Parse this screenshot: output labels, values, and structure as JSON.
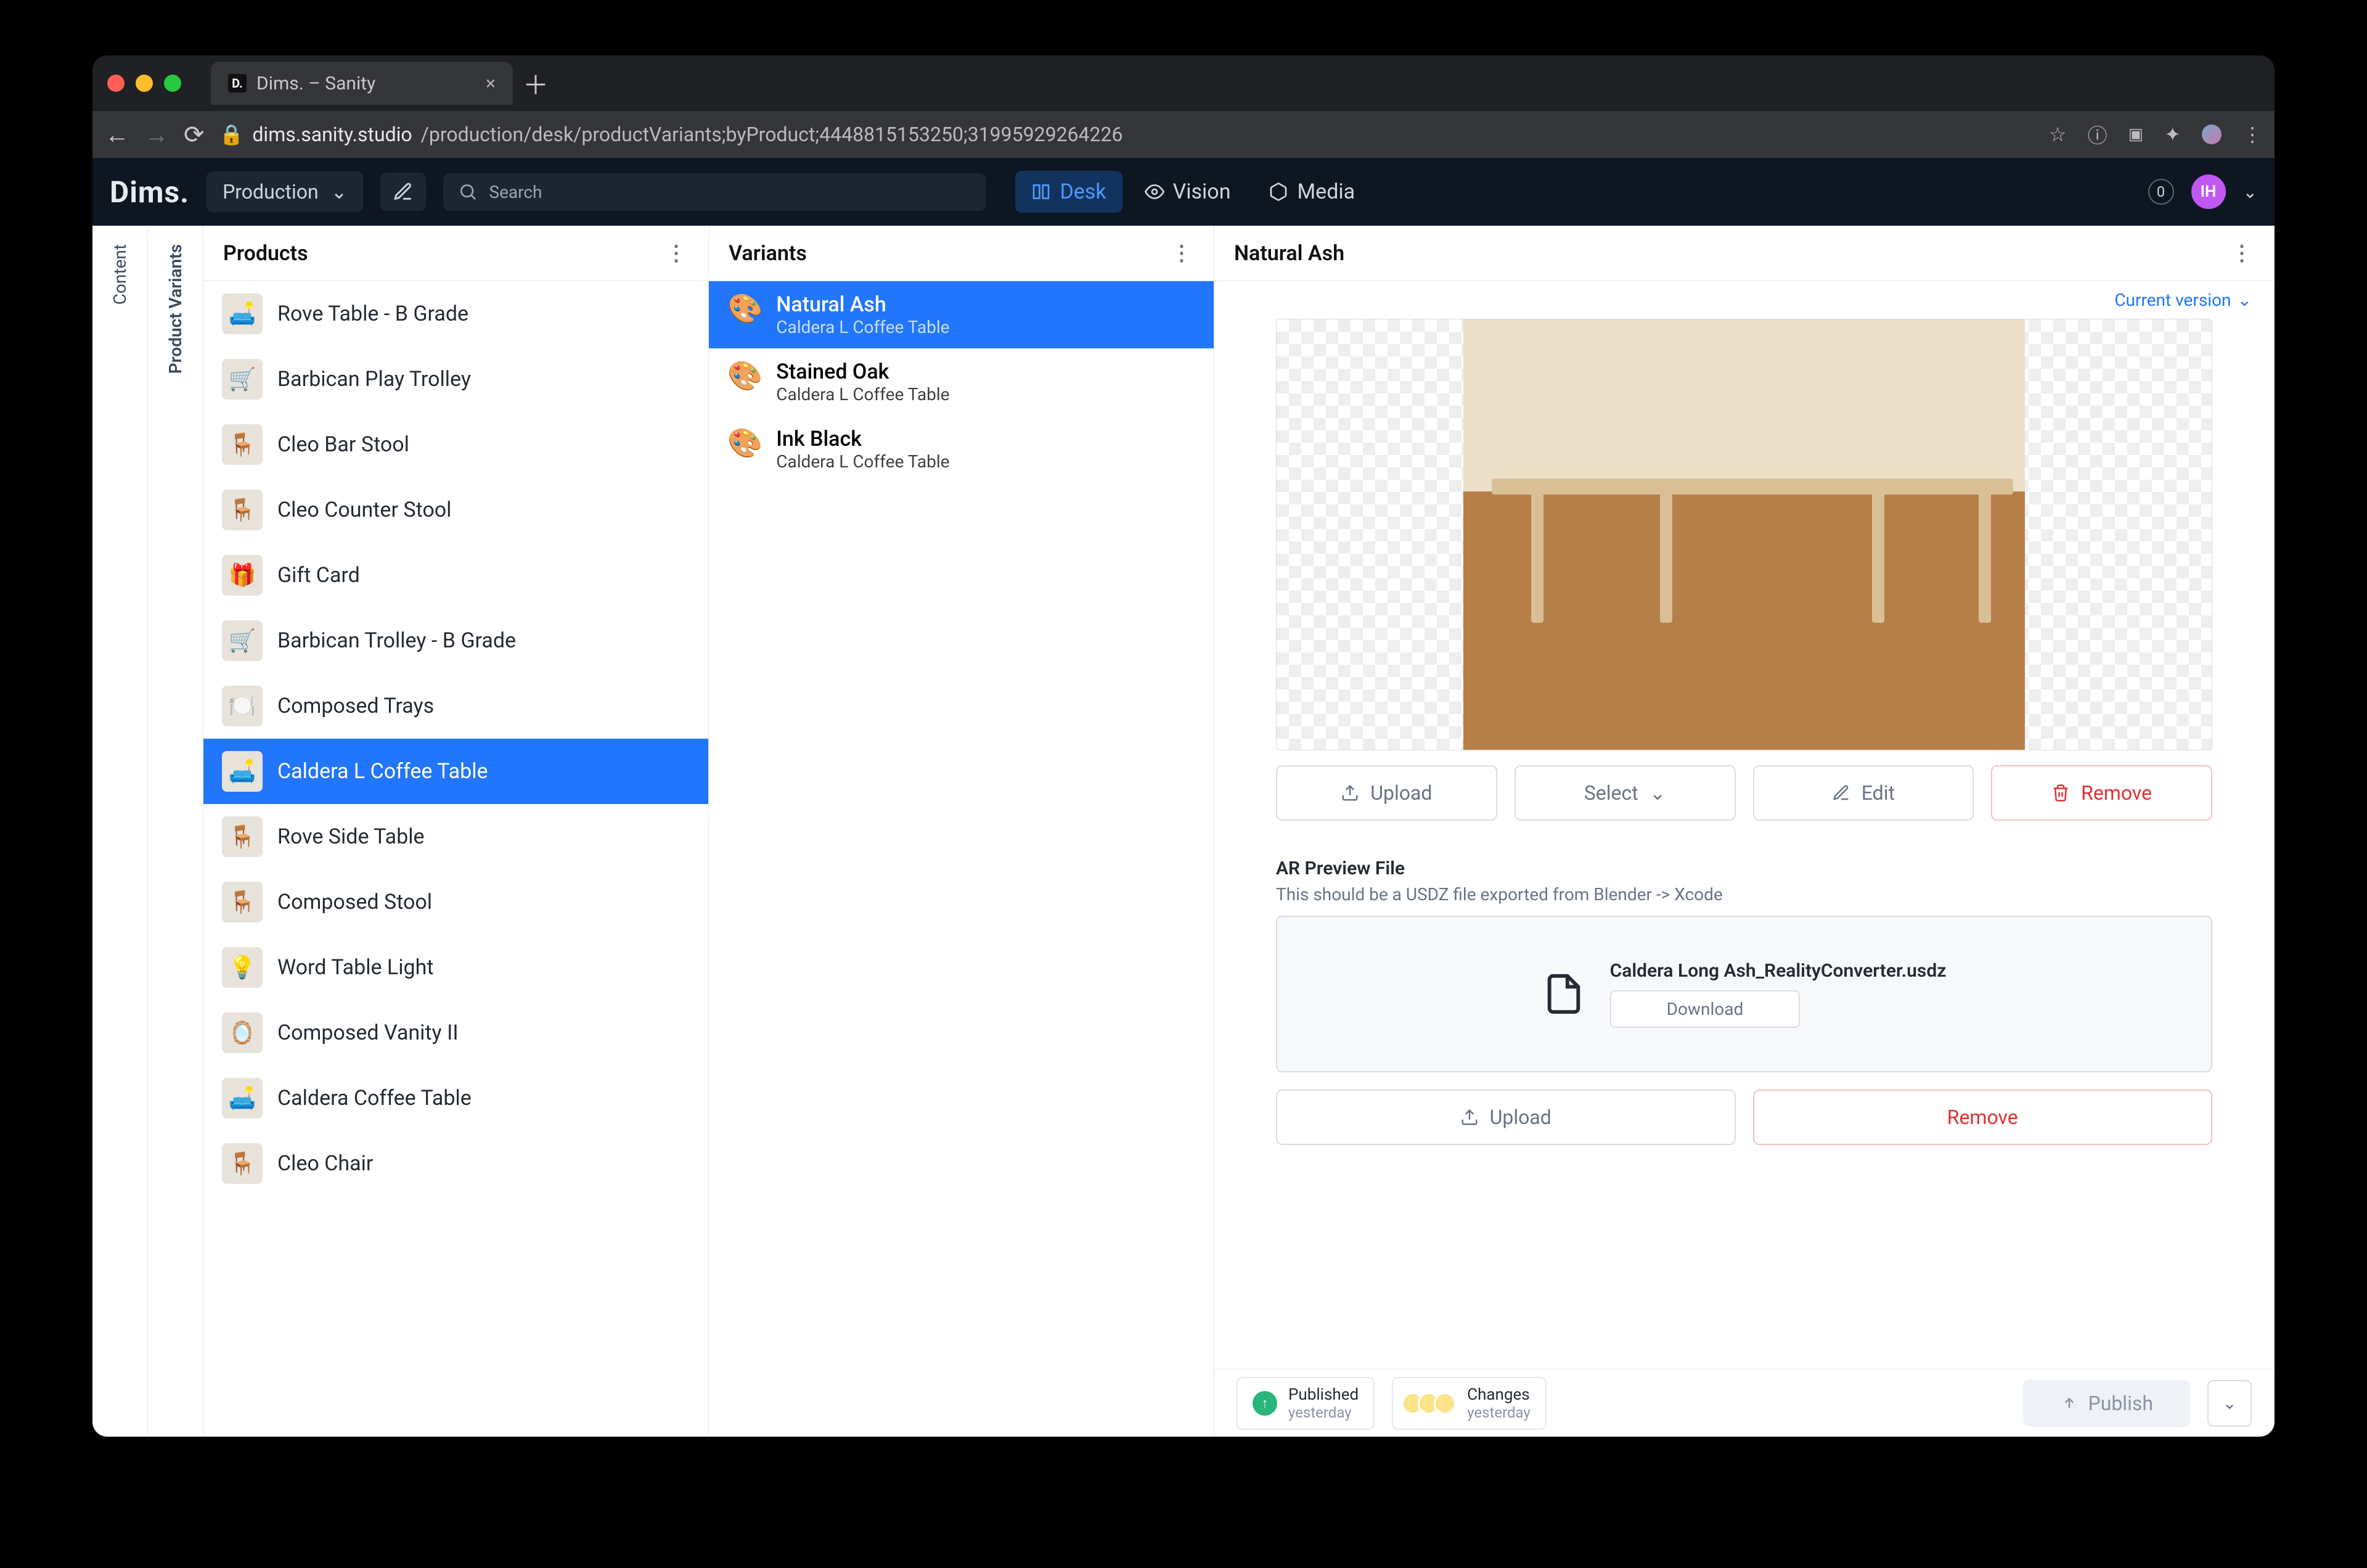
{
  "browser": {
    "tab_title": "Dims. – Sanity",
    "url_host": "dims.sanity.studio",
    "url_path": "/production/desk/productVariants;byProduct;4448815153250;31995929264226"
  },
  "header": {
    "brand": "Dims.",
    "workspace": "Production",
    "search_placeholder": "Search",
    "nav": {
      "desk": "Desk",
      "vision": "Vision",
      "media": "Media"
    },
    "badge": "0",
    "avatar": "IH"
  },
  "rails": {
    "content": "Content",
    "product_variants": "Product Variants"
  },
  "products": {
    "title": "Products",
    "items": [
      "Rove Table - B Grade",
      "Barbican Play Trolley",
      "Cleo Bar Stool",
      "Cleo Counter Stool",
      "Gift Card",
      "Barbican Trolley - B Grade",
      "Composed Trays",
      "Caldera L Coffee Table",
      "Rove Side Table",
      "Composed Stool",
      "Word Table Light",
      "Composed Vanity II",
      "Caldera Coffee Table",
      "Cleo Chair"
    ],
    "selected_index": 7
  },
  "variants": {
    "title": "Variants",
    "items": [
      {
        "title": "Natural Ash",
        "subtitle": "Caldera L Coffee Table"
      },
      {
        "title": "Stained Oak",
        "subtitle": "Caldera L Coffee Table"
      },
      {
        "title": "Ink Black",
        "subtitle": "Caldera L Coffee Table"
      }
    ],
    "selected_index": 0
  },
  "doc": {
    "title": "Natural Ash",
    "version_label": "Current version",
    "image_actions": {
      "upload": "Upload",
      "select": "Select",
      "edit": "Edit",
      "remove": "Remove"
    },
    "ar_field": {
      "label": "AR Preview File",
      "description": "This should be a USDZ file exported from Blender -> Xcode",
      "file_name": "Caldera Long Ash_RealityConverter.usdz",
      "download": "Download",
      "upload": "Upload",
      "remove": "Remove"
    },
    "footer": {
      "published_label": "Published",
      "published_time": "yesterday",
      "changes_label": "Changes",
      "changes_time": "yesterday",
      "publish": "Publish"
    }
  }
}
